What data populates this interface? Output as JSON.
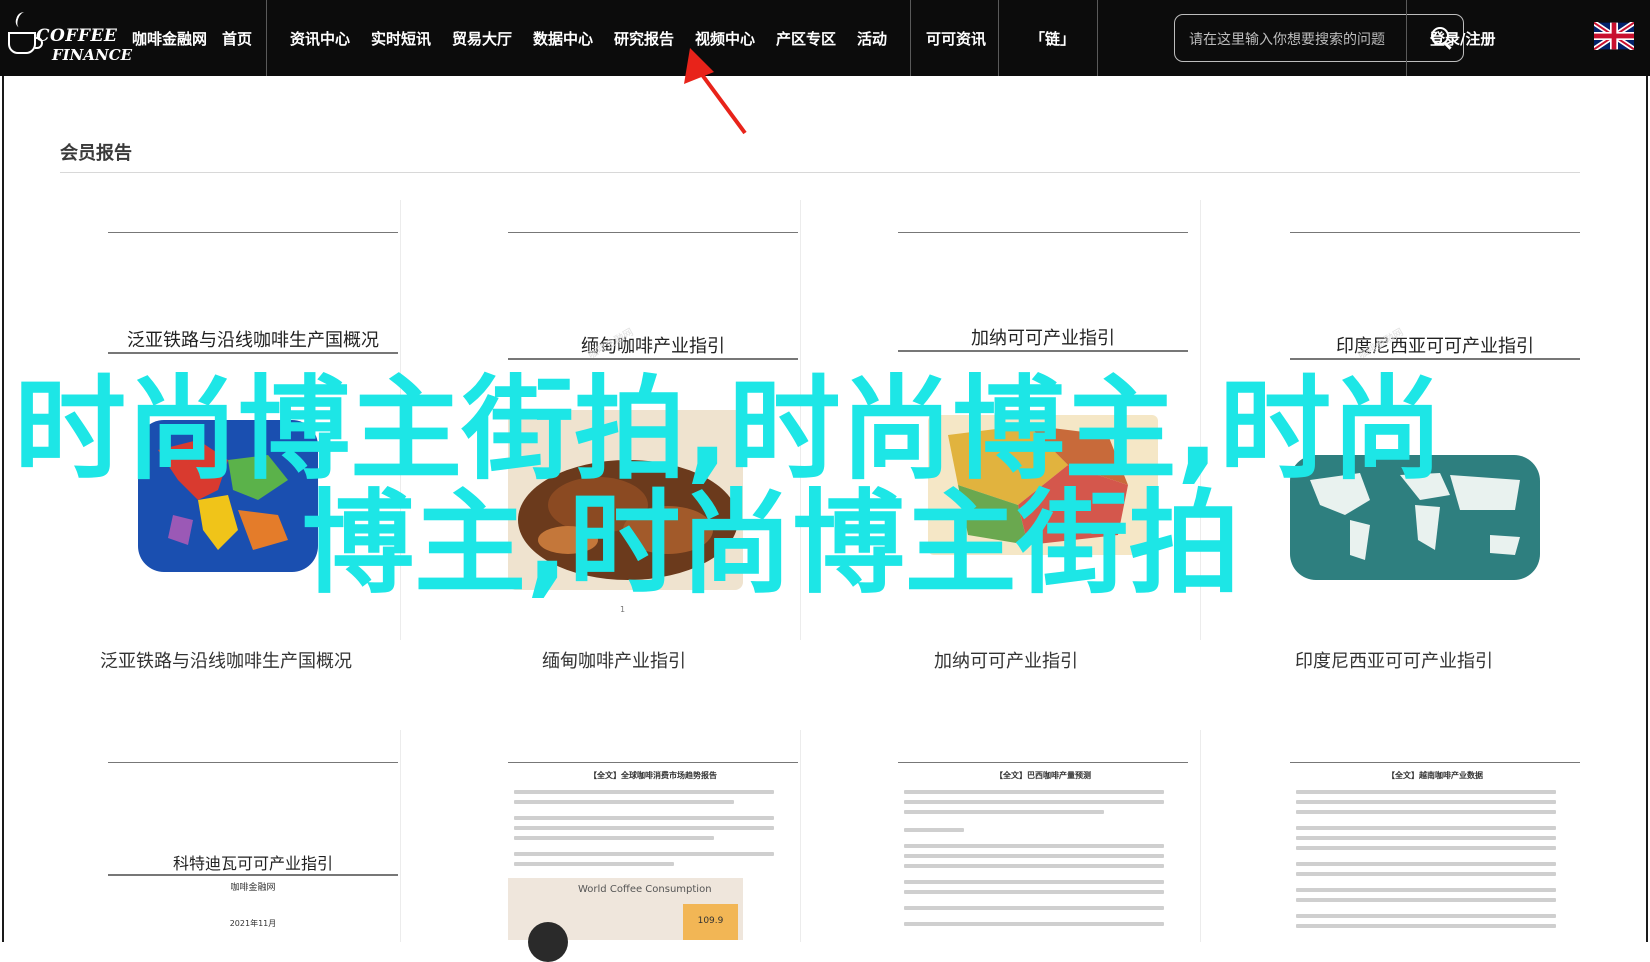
{
  "brand": {
    "logo_line1": "COFFEE",
    "logo_line2": "FINANCE"
  },
  "nav": {
    "items": [
      "咖啡金融网",
      "首页",
      "资讯中心",
      "实时短讯",
      "贸易大厅",
      "数据中心",
      "研究报告",
      "视频中心",
      "产区专区",
      "活动",
      "可可资讯",
      "「链」"
    ],
    "search_placeholder": "请在这里输入你想要搜索的问题",
    "login": "登录/注册"
  },
  "section": {
    "title": "会员报告"
  },
  "reports_row1": [
    {
      "doc_title": "泛亚铁路与沿线咖啡生产国概况",
      "caption": "泛亚铁路与沿线咖啡生产国概况"
    },
    {
      "doc_title": "缅甸咖啡产业指引",
      "caption": "缅甸咖啡产业指引"
    },
    {
      "doc_title": "加纳可可产业指引",
      "caption": "加纳可可产业指引"
    },
    {
      "doc_title": "印度尼西亚可可产业指引",
      "caption": "印度尼西亚可可产业指引"
    }
  ],
  "reports_row2": [
    {
      "doc_title": "科特迪瓦可可产业指引",
      "doc_sub": "咖啡金融网",
      "doc_date": "2021年11月"
    },
    {
      "doc_heading": "【全文】全球咖啡消费市场趋势报告",
      "chart_title": "World Coffee Consumption",
      "chart_value": "109.9"
    },
    {
      "doc_heading": "【全文】巴西咖啡产量预测"
    },
    {
      "doc_heading": "【全文】越南咖啡产业数据"
    }
  ],
  "overlay_text": {
    "line1": "时尚博主街拍,时尚博主,时尚",
    "line2": "博主,时尚博主街拍"
  },
  "page_footer": "1",
  "colors": {
    "nav_bg": "#0c0c0c",
    "overlay": "#1de6e6",
    "arrow": "#e8231a"
  }
}
